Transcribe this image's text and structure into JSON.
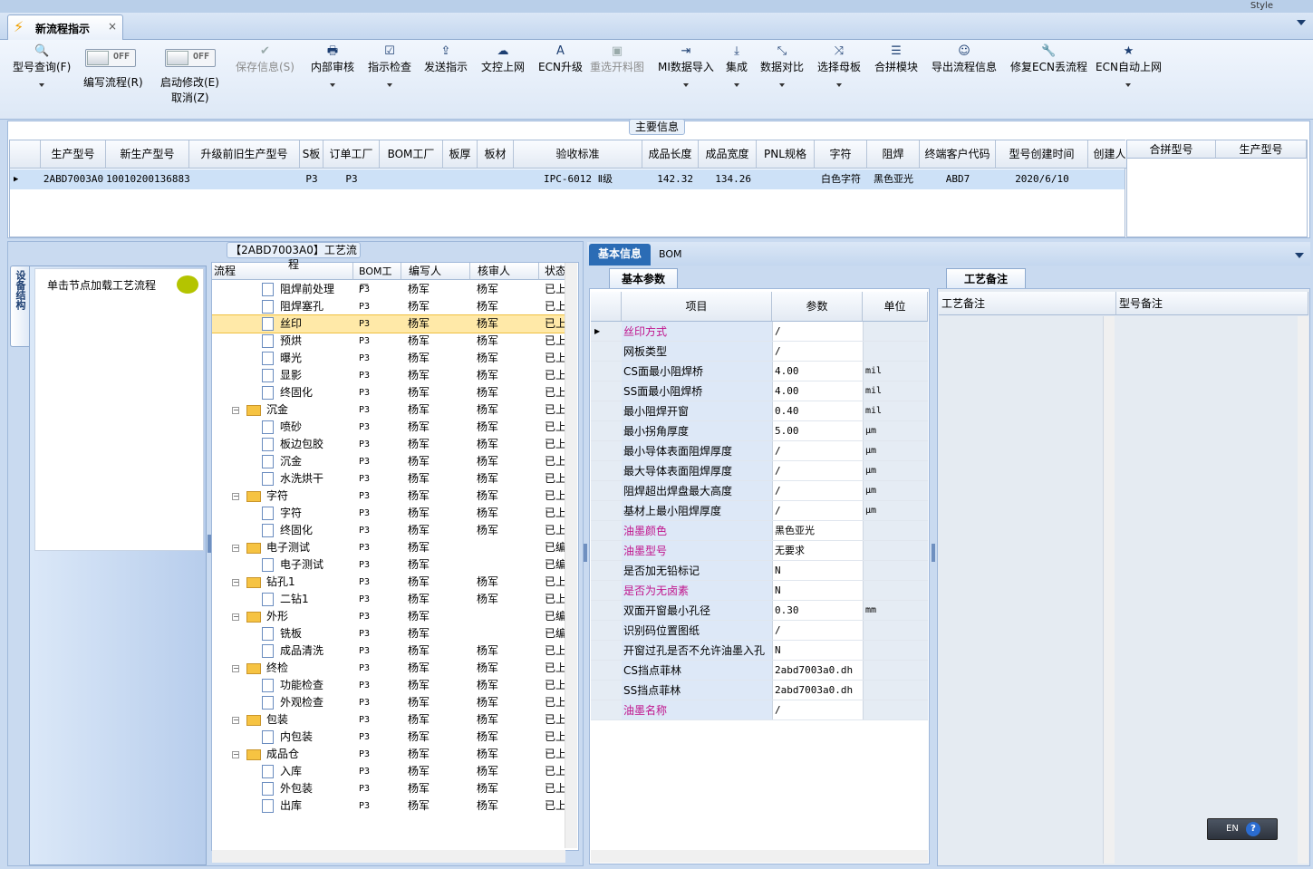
{
  "window": {
    "style_label": "Style"
  },
  "tab": {
    "title": "新流程指示",
    "close": "×"
  },
  "toolbar": {
    "search": "型号查询(F)",
    "edit_flow": "编写流程(R)",
    "start_modify": "启动修改(E)",
    "cancel": "取消(Z)",
    "toggle_off": "OFF",
    "save_info": "保存信息(S)",
    "internal_review": "内部审核",
    "instruction_check": "指示检查",
    "send_instruction": "发送指示",
    "doc_upload": "文控上网",
    "ecn_upgrade": "ECN升级",
    "reselect_image": "重选开料图",
    "mi_import": "MI数据导入",
    "integrate": "集成",
    "data_compare": "数据对比",
    "select_master": "选择母板",
    "merge_module": "合拼模块",
    "export_flow": "导出流程信息",
    "repair_ecn": "修复ECN丢流程",
    "ecn_auto": "ECN自动上网"
  },
  "main_info": {
    "title": "主要信息",
    "columns": [
      "生产型号",
      "新生产型号",
      "升级前旧生产型号",
      "S板",
      "订单工厂",
      "BOM工厂",
      "板厚",
      "板材",
      "验收标准",
      "成品长度",
      "成品宽度",
      "PNL规格",
      "字符",
      "阻焊",
      "终端客户代码",
      "型号创建时间",
      "创建人"
    ],
    "row": [
      "2ABD7003A0",
      "10010200136883",
      "",
      "P3",
      "P3",
      "",
      "",
      "",
      "IPC-6012 Ⅱ级",
      "142.32",
      "134.26",
      "",
      "白色字符",
      "黑色亚光",
      "ABD7",
      "2020/6/10",
      ""
    ],
    "side_columns": [
      "合拼型号",
      "生产型号"
    ]
  },
  "left_nav": {
    "vertical_tab": "设备结构",
    "load_text": "单击节点加载工艺流程"
  },
  "process_tree": {
    "title": "【2ABD7003A0】工艺流程",
    "columns": [
      "流程",
      "BOM工厂",
      "编写人",
      "核审人",
      "状态"
    ],
    "rows": [
      {
        "name": "阻焊前处理",
        "bom": "P3",
        "writer": "杨军",
        "reviewer": "杨军",
        "status": "已上",
        "level": 2
      },
      {
        "name": "阻焊塞孔",
        "bom": "P3",
        "writer": "杨军",
        "reviewer": "杨军",
        "status": "已上",
        "level": 2
      },
      {
        "name": "丝印",
        "bom": "P3",
        "writer": "杨军",
        "reviewer": "杨军",
        "status": "已上",
        "level": 2,
        "selected": true
      },
      {
        "name": "预烘",
        "bom": "P3",
        "writer": "杨军",
        "reviewer": "杨军",
        "status": "已上",
        "level": 2
      },
      {
        "name": "曝光",
        "bom": "P3",
        "writer": "杨军",
        "reviewer": "杨军",
        "status": "已上",
        "level": 2
      },
      {
        "name": "显影",
        "bom": "P3",
        "writer": "杨军",
        "reviewer": "杨军",
        "status": "已上",
        "level": 2
      },
      {
        "name": "终固化",
        "bom": "P3",
        "writer": "杨军",
        "reviewer": "杨军",
        "status": "已上",
        "level": 2
      },
      {
        "name": "沉金",
        "bom": "P3",
        "writer": "杨军",
        "reviewer": "杨军",
        "status": "已上",
        "level": 1
      },
      {
        "name": "喷砂",
        "bom": "P3",
        "writer": "杨军",
        "reviewer": "杨军",
        "status": "已上",
        "level": 2
      },
      {
        "name": "板边包胶",
        "bom": "P3",
        "writer": "杨军",
        "reviewer": "杨军",
        "status": "已上",
        "level": 2
      },
      {
        "name": "沉金",
        "bom": "P3",
        "writer": "杨军",
        "reviewer": "杨军",
        "status": "已上",
        "level": 2
      },
      {
        "name": "水洗烘干",
        "bom": "P3",
        "writer": "杨军",
        "reviewer": "杨军",
        "status": "已上",
        "level": 2
      },
      {
        "name": "字符",
        "bom": "P3",
        "writer": "杨军",
        "reviewer": "杨军",
        "status": "已上",
        "level": 1
      },
      {
        "name": "字符",
        "bom": "P3",
        "writer": "杨军",
        "reviewer": "杨军",
        "status": "已上",
        "level": 2
      },
      {
        "name": "终固化",
        "bom": "P3",
        "writer": "杨军",
        "reviewer": "杨军",
        "status": "已上",
        "level": 2
      },
      {
        "name": "电子测试",
        "bom": "P3",
        "writer": "杨军",
        "reviewer": "",
        "status": "已编",
        "level": 1
      },
      {
        "name": "电子测试",
        "bom": "P3",
        "writer": "杨军",
        "reviewer": "",
        "status": "已编",
        "level": 2
      },
      {
        "name": "钻孔1",
        "bom": "P3",
        "writer": "杨军",
        "reviewer": "杨军",
        "status": "已上",
        "level": 1
      },
      {
        "name": "二钻1",
        "bom": "P3",
        "writer": "杨军",
        "reviewer": "杨军",
        "status": "已上",
        "level": 2
      },
      {
        "name": "外形",
        "bom": "P3",
        "writer": "杨军",
        "reviewer": "",
        "status": "已编",
        "level": 1
      },
      {
        "name": "铣板",
        "bom": "P3",
        "writer": "杨军",
        "reviewer": "",
        "status": "已编",
        "level": 2
      },
      {
        "name": "成品清洗",
        "bom": "P3",
        "writer": "杨军",
        "reviewer": "杨军",
        "status": "已上",
        "level": 2
      },
      {
        "name": "终检",
        "bom": "P3",
        "writer": "杨军",
        "reviewer": "杨军",
        "status": "已上",
        "level": 1
      },
      {
        "name": "功能检查",
        "bom": "P3",
        "writer": "杨军",
        "reviewer": "杨军",
        "status": "已上",
        "level": 2
      },
      {
        "name": "外观检查",
        "bom": "P3",
        "writer": "杨军",
        "reviewer": "杨军",
        "status": "已上",
        "level": 2
      },
      {
        "name": "包装",
        "bom": "P3",
        "writer": "杨军",
        "reviewer": "杨军",
        "status": "已上",
        "level": 1
      },
      {
        "name": "内包装",
        "bom": "P3",
        "writer": "杨军",
        "reviewer": "杨军",
        "status": "已上",
        "level": 2
      },
      {
        "name": "成品仓",
        "bom": "P3",
        "writer": "杨军",
        "reviewer": "杨军",
        "status": "已上",
        "level": 1
      },
      {
        "name": "入库",
        "bom": "P3",
        "writer": "杨军",
        "reviewer": "杨军",
        "status": "已上",
        "level": 2
      },
      {
        "name": "外包装",
        "bom": "P3",
        "writer": "杨军",
        "reviewer": "杨军",
        "status": "已上",
        "level": 2
      },
      {
        "name": "出库",
        "bom": "P3",
        "writer": "杨军",
        "reviewer": "杨军",
        "status": "已上",
        "level": 2
      }
    ]
  },
  "detail_tabs": {
    "basic": "基本信息",
    "bom": "BOM"
  },
  "params": {
    "subtab": "基本参数",
    "columns": [
      "项目",
      "参数",
      "单位"
    ],
    "highlight_color": "#c0148c",
    "rows": [
      {
        "name": "丝印方式",
        "value": "/",
        "unit": "",
        "highlight": true
      },
      {
        "name": "网板类型",
        "value": "/",
        "unit": ""
      },
      {
        "name": "CS面最小阻焊桥",
        "value": "4.00",
        "unit": "mil"
      },
      {
        "name": "SS面最小阻焊桥",
        "value": "4.00",
        "unit": "mil"
      },
      {
        "name": "最小阻焊开窗",
        "value": "0.40",
        "unit": "mil"
      },
      {
        "name": "最小拐角厚度",
        "value": "5.00",
        "unit": "μm"
      },
      {
        "name": "最小导体表面阻焊厚度",
        "value": "/",
        "unit": "μm"
      },
      {
        "name": "最大导体表面阻焊厚度",
        "value": "/",
        "unit": "μm"
      },
      {
        "name": "阻焊超出焊盘最大高度",
        "value": "/",
        "unit": "μm"
      },
      {
        "name": "基材上最小阻焊厚度",
        "value": "/",
        "unit": "μm"
      },
      {
        "name": "油墨颜色",
        "value": "黑色亚光",
        "unit": "",
        "highlight": true
      },
      {
        "name": "油墨型号",
        "value": "无要求",
        "unit": "",
        "highlight": true
      },
      {
        "name": "是否加无铅标记",
        "value": "N",
        "unit": ""
      },
      {
        "name": "是否为无卤素",
        "value": "N",
        "unit": "",
        "highlight": true
      },
      {
        "name": "双面开窗最小孔径",
        "value": "0.30",
        "unit": "mm"
      },
      {
        "name": "识别码位置图纸",
        "value": "/",
        "unit": ""
      },
      {
        "name": "开窗过孔是否不允许油墨入孔",
        "value": "N",
        "unit": ""
      },
      {
        "name": "CS挡点菲林",
        "value": "2abd7003a0.dh",
        "unit": ""
      },
      {
        "name": "SS挡点菲林",
        "value": "2abd7003a0.dh",
        "unit": ""
      },
      {
        "name": "油墨名称",
        "value": "/",
        "unit": "",
        "highlight": true
      }
    ]
  },
  "remarks": {
    "subtab": "工艺备注",
    "columns": [
      "工艺备注",
      "型号备注"
    ]
  },
  "ime": {
    "lang": "EN",
    "help": "?"
  }
}
